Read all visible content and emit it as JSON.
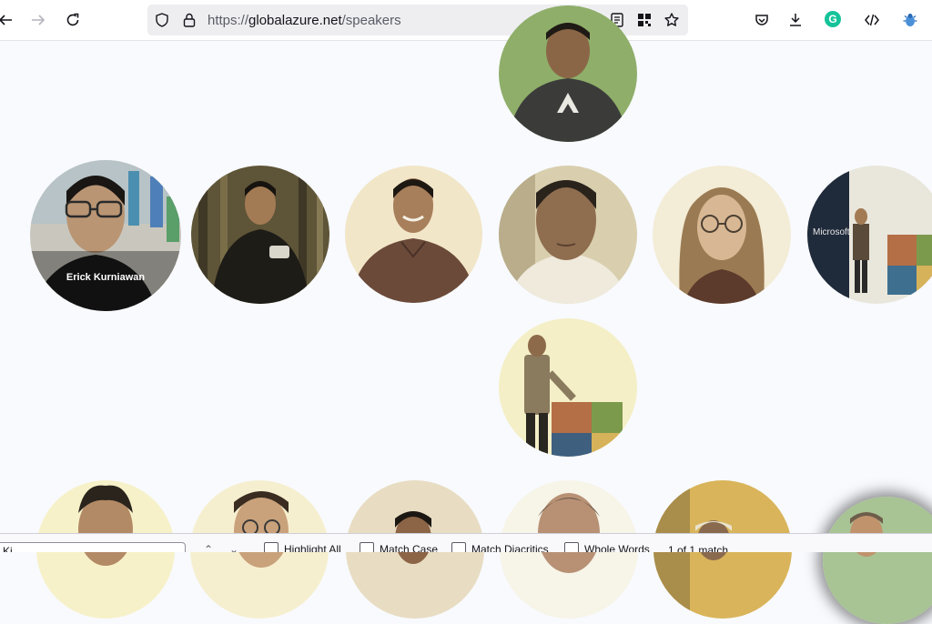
{
  "browser": {
    "url_prefix": "https://",
    "url_domain": "globalazure.net",
    "url_path": "/speakers",
    "grammarly_badge": "G",
    "accent_color": "#0060df"
  },
  "speakers": {
    "highlighted_name": "Erick Kurniawan"
  },
  "findbar": {
    "query": "Ki",
    "highlight_all": "Highlight All",
    "match_case": "Match Case",
    "match_diacritics": "Match Diacritics",
    "whole_words": "Whole Words",
    "status": "1 of 1 match"
  }
}
